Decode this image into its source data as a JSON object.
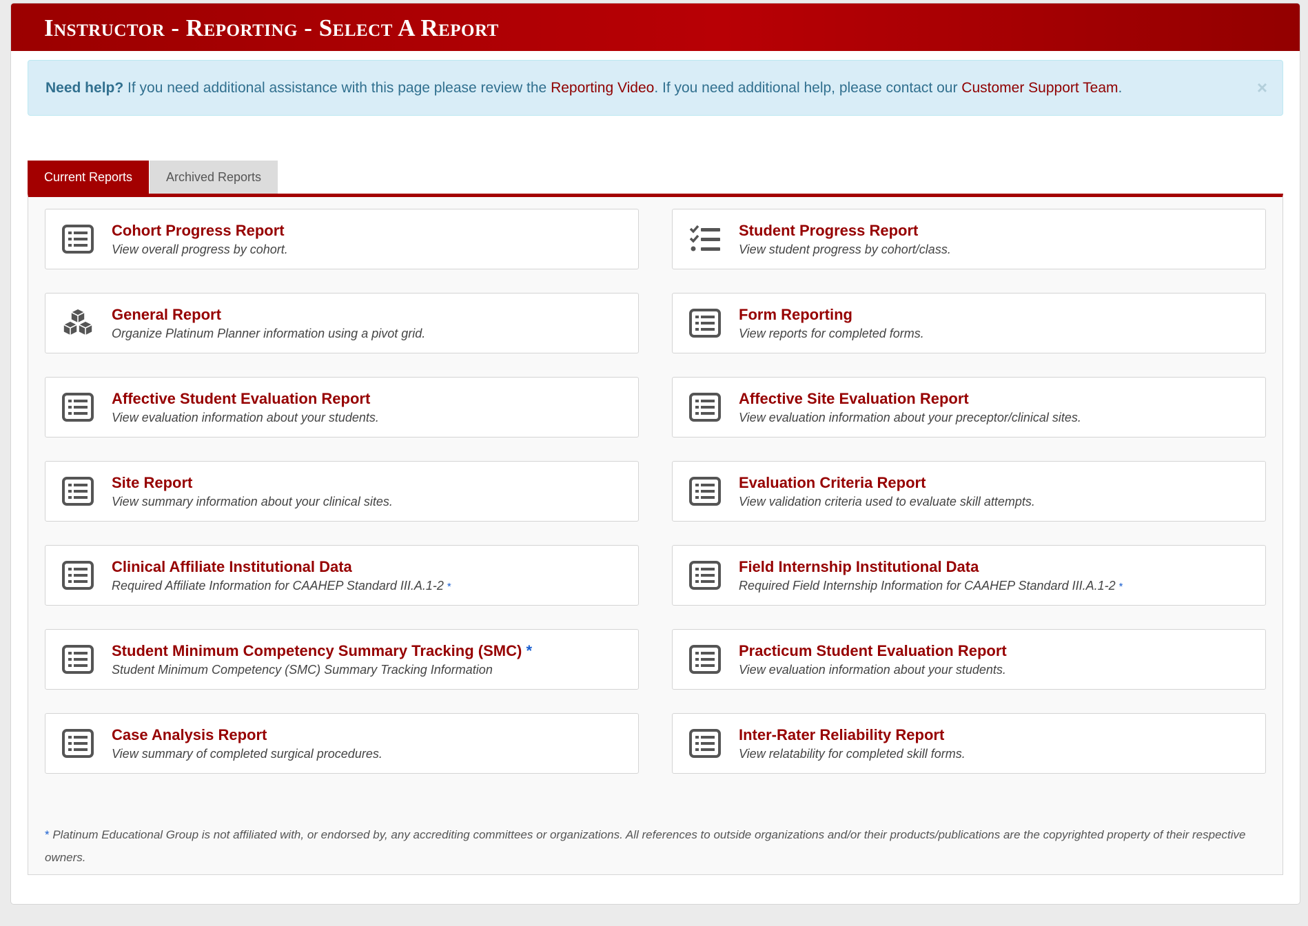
{
  "header": {
    "title": "Instructor - Reporting - Select A Report"
  },
  "alert": {
    "lead": "Need help?",
    "text1": " If you need additional assistance with this page please review the ",
    "link1": "Reporting Video",
    "text2": ". If you need additional help, please contact our ",
    "link2": "Customer Support Team",
    "text3": ".",
    "close": "×"
  },
  "tabs": [
    {
      "label": "Current Reports"
    },
    {
      "label": "Archived Reports"
    }
  ],
  "reports": [
    {
      "title": "Cohort Progress Report",
      "desc": "View overall progress by cohort.",
      "icon": "list-icon"
    },
    {
      "title": "Student Progress Report",
      "desc": "View student progress by cohort/class.",
      "icon": "tasks-icon"
    },
    {
      "title": "General Report",
      "desc": "Organize Platinum Planner information using a pivot grid.",
      "icon": "cubes-icon"
    },
    {
      "title": "Form Reporting",
      "desc": "View reports for completed forms.",
      "icon": "list-icon"
    },
    {
      "title": "Affective Student Evaluation Report",
      "desc": "View evaluation information about your students.",
      "icon": "list-icon"
    },
    {
      "title": "Affective Site Evaluation Report",
      "desc": "View evaluation information about your preceptor/clinical sites.",
      "icon": "list-icon"
    },
    {
      "title": "Site Report",
      "desc": "View summary information about your clinical sites.",
      "icon": "list-icon"
    },
    {
      "title": "Evaluation Criteria Report",
      "desc": "View validation criteria used to evaluate skill attempts.",
      "icon": "list-icon"
    },
    {
      "title": "Clinical Affiliate Institutional Data",
      "desc": "Required Affiliate Information for CAAHEP Standard III.A.1-2",
      "icon": "list-icon",
      "desc_star": "*"
    },
    {
      "title": "Field Internship Institutional Data",
      "desc": "Required Field Internship Information for CAAHEP Standard III.A.1-2",
      "icon": "list-icon",
      "desc_star": "*"
    },
    {
      "title": "Student Minimum Competency Summary Tracking (SMC)",
      "desc": "Student Minimum Competency (SMC) Summary Tracking Information",
      "icon": "list-icon",
      "title_star": "*"
    },
    {
      "title": "Practicum Student Evaluation Report",
      "desc": "View evaluation information about your students.",
      "icon": "list-icon"
    },
    {
      "title": "Case Analysis Report",
      "desc": "View summary of completed surgical procedures.",
      "icon": "list-icon"
    },
    {
      "title": "Inter-Rater Reliability Report",
      "desc": "View relatability for completed skill forms.",
      "icon": "list-icon"
    }
  ],
  "footnote": {
    "star": "*",
    "text": " Platinum Educational Group is not affiliated with, or endorsed by, any accrediting committees or organizations. All references to outside organizations and/or their products/publications are the copyrighted property of their respective owners."
  },
  "colors": {
    "brand": "#a30000",
    "link": "#960000",
    "info_bg": "#d9edf7",
    "star": "#1a5fd0"
  }
}
